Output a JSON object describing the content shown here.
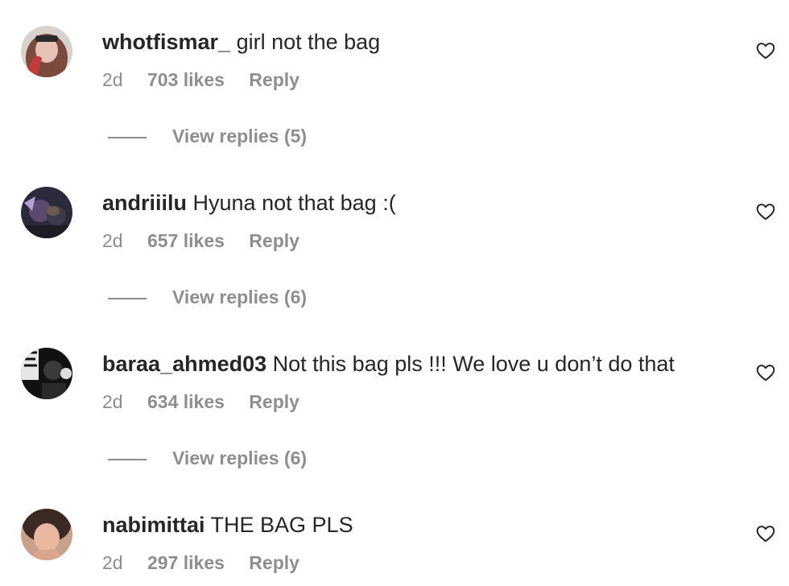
{
  "comments": [
    {
      "username": "whotfismar_",
      "text": "girl not the bag",
      "time": "2d",
      "likes": "703 likes",
      "reply_label": "Reply",
      "view_replies": "View replies (5)",
      "avatar_colors": [
        "#8a5a4a",
        "#c23a3a"
      ]
    },
    {
      "username": "andriiilu",
      "text": "Hyuna not that bag :(",
      "time": "2d",
      "likes": "657 likes",
      "reply_label": "Reply",
      "view_replies": "View replies (6)",
      "avatar_colors": [
        "#2b2a3a",
        "#b59fd6"
      ]
    },
    {
      "username": "baraa_ahmed03",
      "text": "Not this bag pls !!! We love u don’t do that",
      "time": "2d",
      "likes": "634 likes",
      "reply_label": "Reply",
      "view_replies": "View replies (6)",
      "avatar_colors": [
        "#111111",
        "#e6e6e6"
      ]
    },
    {
      "username": "nabimittai",
      "text": "THE BAG PLS",
      "time": "2d",
      "likes": "297 likes",
      "reply_label": "Reply",
      "avatar_colors": [
        "#d9a58c",
        "#3b2a24"
      ]
    }
  ],
  "icons": {
    "like": "heart-outline-icon"
  },
  "colors": {
    "text_primary": "#262626",
    "text_secondary": "#8e8e8e",
    "background": "#ffffff"
  }
}
